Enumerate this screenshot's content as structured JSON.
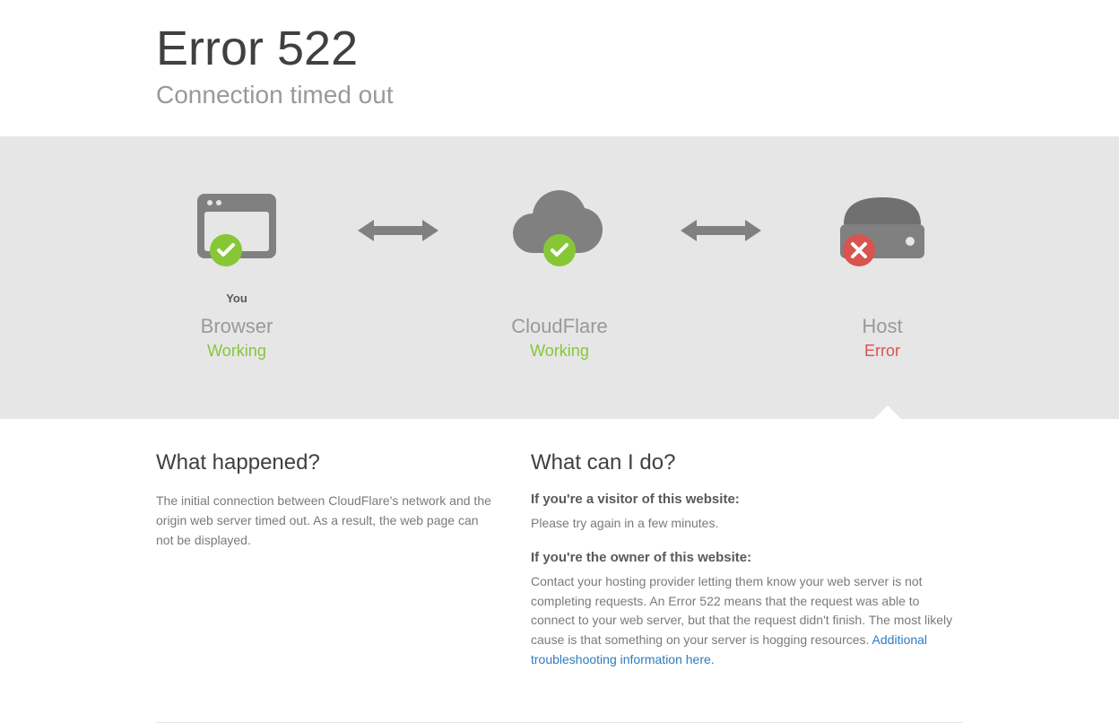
{
  "header": {
    "title": "Error 522",
    "subtitle": "Connection timed out"
  },
  "nodes": {
    "browser": {
      "sublabel": "You",
      "title": "Browser",
      "status": "Working"
    },
    "cloud": {
      "sublabel": "",
      "title": "CloudFlare",
      "status": "Working"
    },
    "host": {
      "sublabel": "",
      "title": "Host",
      "status": "Error"
    }
  },
  "explain": {
    "left": {
      "heading": "What happened?",
      "body": "The initial connection between CloudFlare's network and the origin web server timed out. As a result, the web page can not be displayed."
    },
    "right": {
      "heading": "What can I do?",
      "visitor_heading": "If you're a visitor of this website:",
      "visitor_body": "Please try again in a few minutes.",
      "owner_heading": "If you're the owner of this website:",
      "owner_body": "Contact your hosting provider letting them know your web server is not completing requests. An Error 522 means that the request was able to connect to your web server, but that the request didn't finish. The most likely cause is that something on your server is hogging resources. ",
      "owner_link": "Additional troubleshooting information here."
    }
  },
  "colors": {
    "ok": "#87c735",
    "err": "#d9534f"
  }
}
